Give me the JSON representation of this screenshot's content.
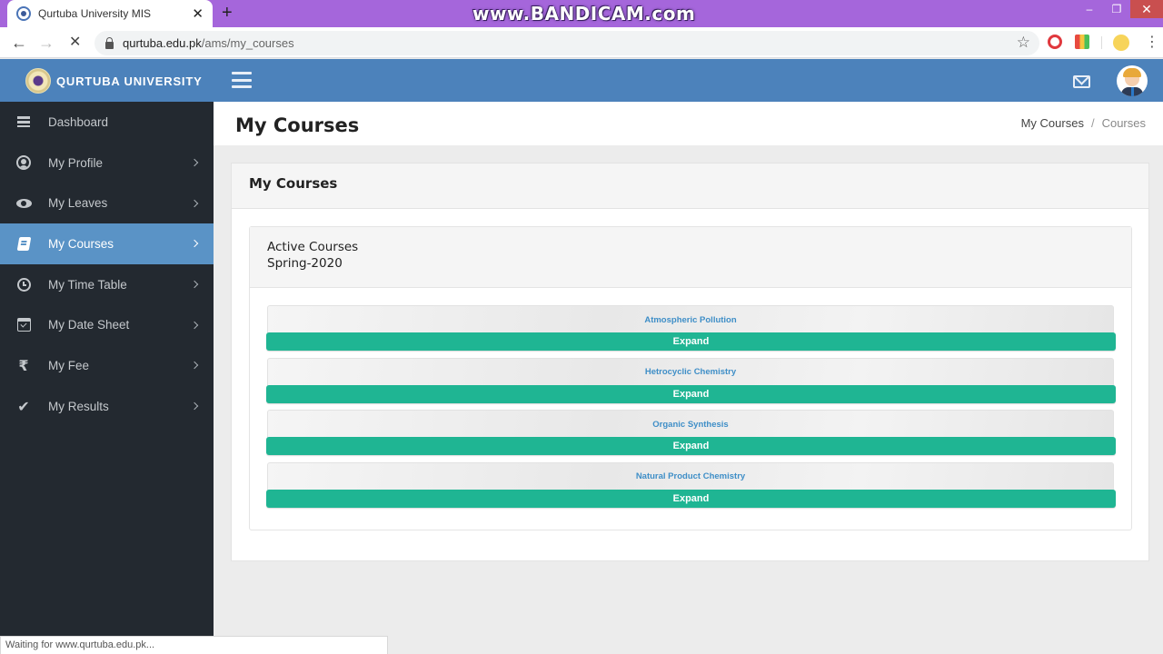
{
  "browser": {
    "tab_title": "Qurtuba University MIS",
    "url_host": "qurtuba.edu.pk",
    "url_path": "/ams/my_courses",
    "watermark": "www.BANDICAM.com",
    "status_text": "Waiting for www.qurtuba.edu.pk...",
    "icons": {
      "back": "←",
      "forward": "→",
      "stop": "✕",
      "star": "☆",
      "menu": "⋮",
      "new_tab": "+",
      "close_tab": "✕",
      "minimize": "–",
      "restore": "❐",
      "close_window": "✕"
    }
  },
  "header": {
    "brand": "QURTUBA UNIVERSITY",
    "colors": {
      "header_bg": "#4c82bb",
      "sidebar_bg": "#232930",
      "active_item": "#5a93c6",
      "expand_button": "#1fb593",
      "course_link": "#3e8ec7"
    }
  },
  "sidebar": {
    "items": [
      {
        "label": "Dashboard",
        "icon": "bars-icon",
        "active": false,
        "has_submenu": false
      },
      {
        "label": "My Profile",
        "icon": "user-circle-icon",
        "active": false,
        "has_submenu": true
      },
      {
        "label": "My Leaves",
        "icon": "eye-icon",
        "active": false,
        "has_submenu": true
      },
      {
        "label": "My Courses",
        "icon": "book-icon",
        "active": true,
        "has_submenu": true
      },
      {
        "label": "My Time Table",
        "icon": "clock-icon",
        "active": false,
        "has_submenu": true
      },
      {
        "label": "My Date Sheet",
        "icon": "calendar-check-icon",
        "active": false,
        "has_submenu": true
      },
      {
        "label": "My Fee",
        "icon": "rupee-icon",
        "glyph": "₹",
        "active": false,
        "has_submenu": true
      },
      {
        "label": "My Results",
        "icon": "check-icon",
        "glyph": "✔",
        "active": false,
        "has_submenu": true
      }
    ]
  },
  "page": {
    "title": "My Courses",
    "breadcrumb": {
      "parent": "My Courses",
      "separator": "/",
      "current": "Courses"
    },
    "card_title": "My Courses",
    "section_title": "Active Courses",
    "semester": "Spring-2020",
    "courses": [
      {
        "name": "Atmospheric Pollution",
        "button": "Expand"
      },
      {
        "name": "Hetrocyclic Chemistry",
        "button": "Expand"
      },
      {
        "name": "Organic Synthesis",
        "button": "Expand"
      },
      {
        "name": "Natural Product Chemistry",
        "button": "Expand"
      }
    ]
  }
}
